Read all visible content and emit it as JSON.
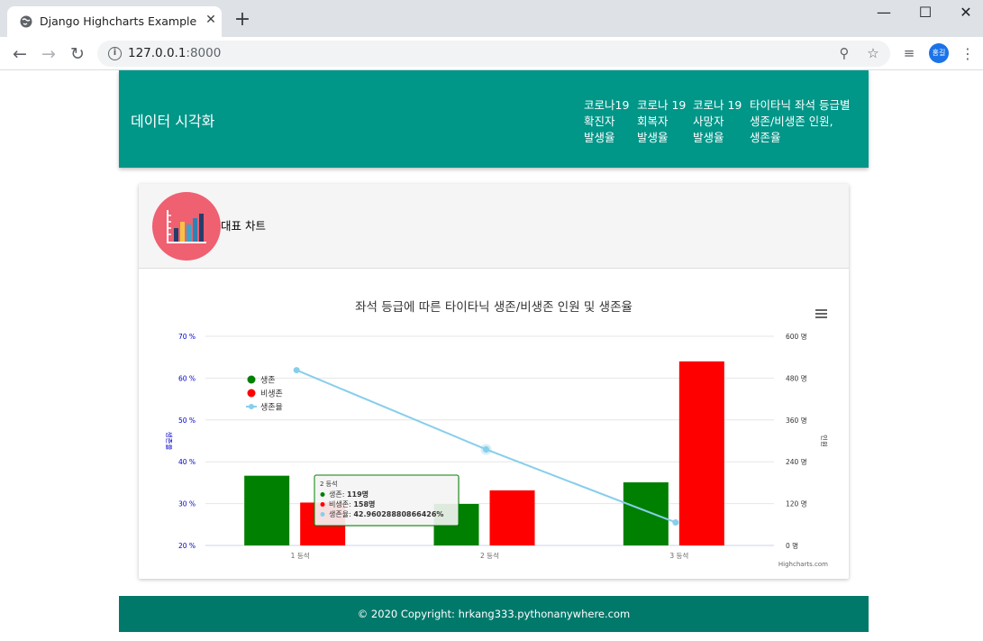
{
  "browser": {
    "tab_title": "Django Highcharts Example",
    "tab_close": "✕",
    "new_tab": "+",
    "url_host": "127.0.0.1",
    "url_port": ":8000",
    "profile_initials": "홍길",
    "window_controls": [
      "—",
      "☐",
      "✕"
    ],
    "icons": [
      "back-icon",
      "forward-icon",
      "reload-icon",
      "info-icon",
      "zoom-icon",
      "star-icon",
      "media-icon",
      "more-icon"
    ]
  },
  "navbar": {
    "brand": "데이터 시각화",
    "links": [
      [
        "코로나19",
        "확진자",
        "발생율"
      ],
      [
        "코로나 19",
        "회복자",
        "발생율"
      ],
      [
        "코로나 19",
        "사망자",
        "발생율"
      ],
      [
        "타이타닉 좌석 등급별",
        "생존/비생존 인원,",
        "생존율"
      ]
    ],
    "color": "#009688"
  },
  "card": {
    "title": "대표 차트",
    "icon": "bar-chart-icon"
  },
  "chart_data": {
    "type": "bar",
    "title": "좌석 등급에 따른 타이타닉 생존/비생존 인원 및 생존율",
    "categories": [
      "1 등석",
      "2 등석",
      "3 등석"
    ],
    "series": [
      {
        "name": "생존",
        "type": "bar",
        "axis": "right",
        "color": "#008000",
        "values": [
          200,
          119,
          181
        ]
      },
      {
        "name": "비생존",
        "type": "bar",
        "axis": "right",
        "color": "#ff0000",
        "values": [
          123,
          158,
          528
        ]
      },
      {
        "name": "생존율",
        "type": "line",
        "axis": "left",
        "color": "#87ceeb",
        "values": [
          61.9,
          42.96,
          25.5
        ]
      }
    ],
    "y_left": {
      "label": "생존율",
      "ticks": [
        "20 %",
        "30 %",
        "40 %",
        "50 %",
        "60 %",
        "70 %"
      ],
      "range": [
        20,
        70
      ]
    },
    "y_right": {
      "label": "인원",
      "ticks": [
        "0 명",
        "120 명",
        "240 명",
        "360 명",
        "480 명",
        "600 명"
      ],
      "range": [
        0,
        600
      ]
    },
    "grid": true,
    "legend": "top-left",
    "menu_icon": "hamburger-icon",
    "credits": "Highcharts.com",
    "tooltip": {
      "header": "2 등석",
      "rows": [
        {
          "label": "생존",
          "value": "119명",
          "color": "#008000"
        },
        {
          "label": "비생존",
          "value": "158명",
          "color": "#ff0000"
        },
        {
          "label": "생존율",
          "value": "42.96028880866426%",
          "color": "#87ceeb"
        }
      ]
    }
  },
  "footer": {
    "prefix": "© 2020 Copyright: ",
    "link": "hrkang333.pythonanywhere.com",
    "color": "#00796b"
  }
}
